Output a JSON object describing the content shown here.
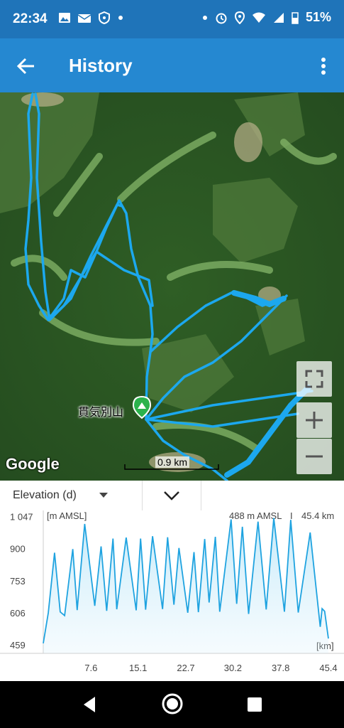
{
  "status_bar": {
    "time": "22:34",
    "battery": "51%"
  },
  "app_bar": {
    "title": "History"
  },
  "map": {
    "peak_label": "貫気別山",
    "scale_label": "0.9 km",
    "attribution": "Google"
  },
  "selector": {
    "metric": "Elevation (d)"
  },
  "chart_data": {
    "type": "area",
    "unit_label": "[m AMSL]",
    "xlabel": "[km]",
    "readout": {
      "elevation": "488 m AMSL",
      "distance": "45.4 km"
    },
    "y_ticks": [
      "1 047",
      "900",
      "753",
      "606",
      "459"
    ],
    "y_tick_values": [
      1047,
      900,
      753,
      606,
      459
    ],
    "x_ticks": [
      "7.6",
      "15.1",
      "22.7",
      "30.2",
      "37.8",
      "45.4"
    ],
    "x_tick_values": [
      7.6,
      15.1,
      22.7,
      30.2,
      37.8,
      45.4
    ],
    "xlim": [
      0,
      45.4
    ],
    "ylim": [
      420,
      1075
    ],
    "x": [
      0,
      0.8,
      1.8,
      2.7,
      3.4,
      4.7,
      5.4,
      6.6,
      8.2,
      9.2,
      10.1,
      11.1,
      11.7,
      13.2,
      14.8,
      15.5,
      16.3,
      17.4,
      19.0,
      19.8,
      20.8,
      21.6,
      23.0,
      24.0,
      24.7,
      25.7,
      26.4,
      27.4,
      28.1,
      29.9,
      30.8,
      31.7,
      32.7,
      34.2,
      35.5,
      36.7,
      38.4,
      39.4,
      40.6,
      42.5,
      44.1,
      44.4,
      44.8,
      45.4
    ],
    "y": [
      466,
      606,
      881,
      610,
      593,
      898,
      618,
      1013,
      638,
      910,
      615,
      946,
      622,
      951,
      617,
      946,
      620,
      957,
      623,
      952,
      643,
      903,
      606,
      884,
      609,
      944,
      653,
      954,
      611,
      1034,
      647,
      1000,
      601,
      1024,
      621,
      1040,
      611,
      1032,
      607,
      974,
      542,
      625,
      613,
      488
    ],
    "color": "#1fa3e0"
  }
}
